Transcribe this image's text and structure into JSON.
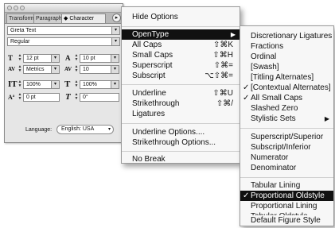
{
  "panel": {
    "tabs": [
      "Transform",
      "Paragraph",
      "◆ Character"
    ],
    "font_family": "Greta Text",
    "font_style": "Regular",
    "size": "12 pt",
    "leading": "10 pt",
    "kerning": "Metrics",
    "tracking": "10",
    "vertical_scale": "100%",
    "horizontal_scale": "100%",
    "baseline_shift": "0 pt",
    "skew": "0°",
    "language_label": "Language:",
    "language": "English: USA"
  },
  "main_menu": {
    "hide_options": "Hide Options",
    "opentype": "OpenType",
    "items": [
      {
        "label": "All Caps",
        "shortcut": "⇧⌘K"
      },
      {
        "label": "Small Caps",
        "shortcut": "⇧⌘H"
      },
      {
        "label": "Superscript",
        "shortcut": "⇧⌘="
      },
      {
        "label": "Subscript",
        "shortcut": "⌥⇧⌘="
      },
      {
        "label": "Underline",
        "shortcut": "⇧⌘U"
      },
      {
        "label": "Strikethrough",
        "shortcut": "⇧⌘/"
      },
      {
        "label": "Ligatures",
        "shortcut": ""
      },
      {
        "label": "Underline Options....",
        "shortcut": ""
      },
      {
        "label": "Strikethrough Options...",
        "shortcut": ""
      },
      {
        "label": "No Break",
        "shortcut": ""
      }
    ]
  },
  "sub_menu": {
    "items": [
      {
        "label": "Discretionary Ligatures",
        "checked": false
      },
      {
        "label": "Fractions",
        "checked": false
      },
      {
        "label": "Ordinal",
        "checked": false
      },
      {
        "label": "[Swash]",
        "checked": false
      },
      {
        "label": "[Titling Alternates]",
        "checked": false
      },
      {
        "label": "[Contextual Alternates]",
        "checked": true
      },
      {
        "label": "All Small Caps",
        "checked": true
      },
      {
        "label": "Slashed Zero",
        "checked": false
      },
      {
        "label": "Stylistic Sets",
        "checked": false,
        "submenu": true
      },
      {
        "label": "Superscript/Superior",
        "checked": false
      },
      {
        "label": "Subscript/Inferior",
        "checked": false
      },
      {
        "label": "Numerator",
        "checked": false
      },
      {
        "label": "Denominator",
        "checked": false
      },
      {
        "label": "Tabular Lining",
        "checked": false
      },
      {
        "label": "Proportional Oldstyle",
        "checked": true,
        "highlighted": true
      },
      {
        "label": "Proportional Lining",
        "checked": false
      },
      {
        "label": "Tabular Oldstyle",
        "checked": false
      },
      {
        "label": "Default Figure Style",
        "checked": false
      }
    ]
  },
  "glyphs": {
    "check": "✓",
    "arrow": "▶",
    "select": "▾",
    "spin_up": "▲",
    "spin_down": "▼"
  }
}
